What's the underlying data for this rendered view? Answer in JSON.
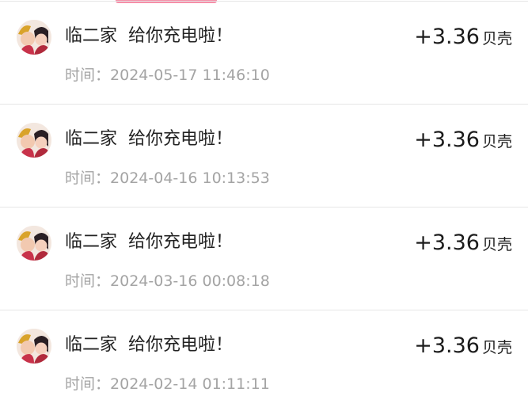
{
  "records": [
    {
      "name": "临二家",
      "message": "给你充电啦！",
      "time_label": "时间：",
      "time": "2024-05-17 11:46:10",
      "amount": "+3.36",
      "unit": "贝壳"
    },
    {
      "name": "临二家",
      "message": "给你充电啦！",
      "time_label": "时间：",
      "time": "2024-04-16 10:13:53",
      "amount": "+3.36",
      "unit": "贝壳"
    },
    {
      "name": "临二家",
      "message": "给你充电啦！",
      "time_label": "时间：",
      "time": "2024-03-16 00:08:18",
      "amount": "+3.36",
      "unit": "贝壳"
    },
    {
      "name": "临二家",
      "message": "给你充电啦！",
      "time_label": "时间：",
      "time": "2024-02-14 01:11:11",
      "amount": "+3.36",
      "unit": "贝壳"
    }
  ],
  "icons": {
    "avatar": "user-avatar-icon"
  },
  "colors": {
    "accent": "#f58fa8",
    "time_text": "#a4a4a4",
    "divider": "#e6e6e6"
  }
}
